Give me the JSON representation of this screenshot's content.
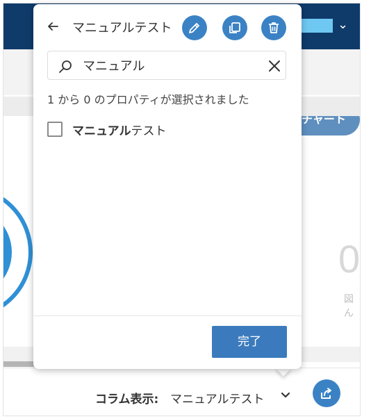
{
  "header": {
    "chart_button_label": "チャート"
  },
  "background": {
    "value_partial": "0",
    "label_partial": "図ん"
  },
  "popover": {
    "title": "マニュアルテスト",
    "search": {
      "value": "マニュアル",
      "placeholder": ""
    },
    "selection_status": "1 から 0 のプロパティが選択されました",
    "options": [
      {
        "match": "マニュアル",
        "rest": "テスト",
        "checked": false
      }
    ],
    "done_label": "完了"
  },
  "footer": {
    "column_label": "コラム表示:",
    "column_value": "マニュアルテスト"
  },
  "colors": {
    "accent": "#3b82c5",
    "topbar": "#0f3b6b",
    "chip": "#6ec8f2",
    "chart": "#2f90d6"
  },
  "icons": [
    "back-arrow-icon",
    "pencil-icon",
    "copy-icon",
    "trash-icon",
    "search-icon",
    "close-icon",
    "chevron-down-icon",
    "share-icon"
  ]
}
